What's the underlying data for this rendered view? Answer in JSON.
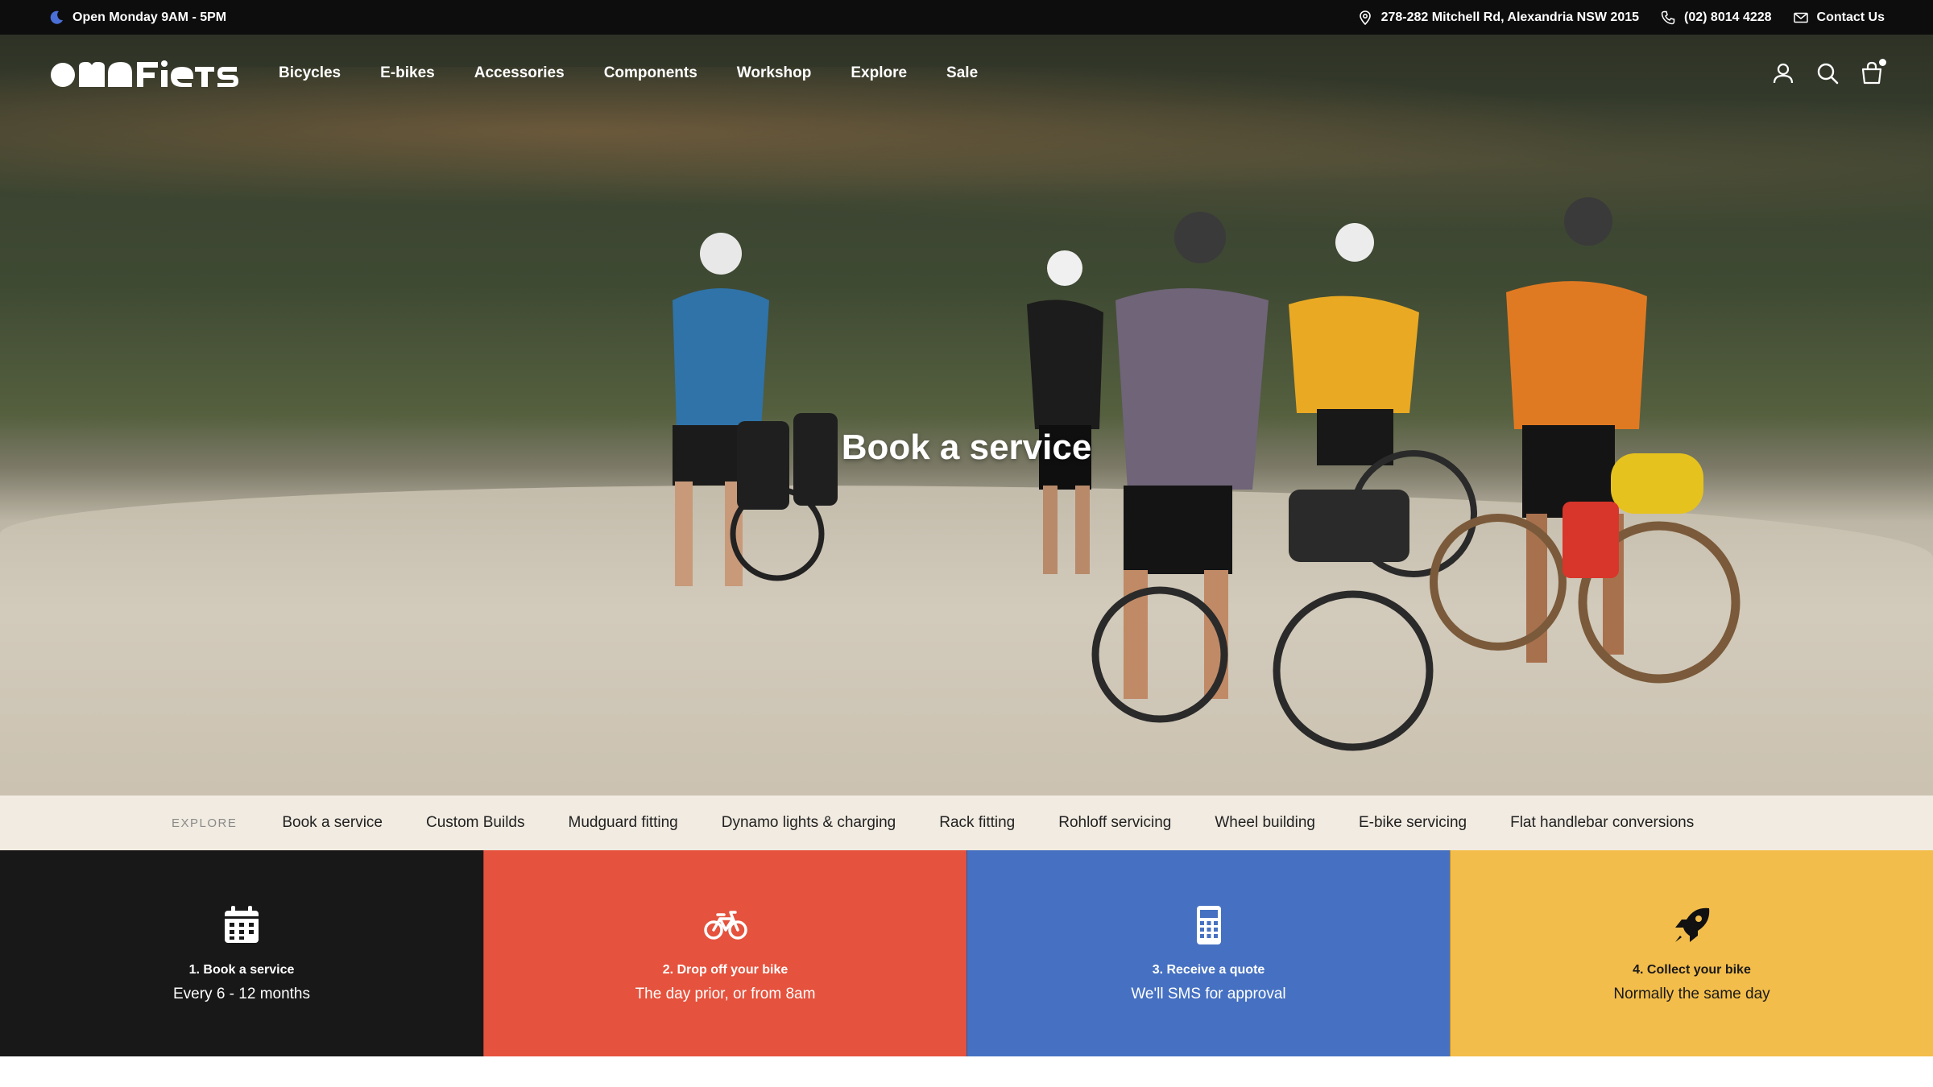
{
  "topbar": {
    "hours": "Open Monday 9AM - 5PM",
    "hours_icon": "moon-icon",
    "address": "278-282 Mitchell Rd, Alexandria NSW 2015",
    "address_icon": "map-pin-icon",
    "phone": "(02) 8014 4228",
    "phone_icon": "phone-icon",
    "contact": "Contact Us",
    "contact_icon": "envelope-icon"
  },
  "header": {
    "logo": "omafiets",
    "nav": [
      "Bicycles",
      "E-bikes",
      "Accessories",
      "Components",
      "Workshop",
      "Explore",
      "Sale"
    ],
    "icons": [
      "account-icon",
      "search-icon",
      "cart-icon"
    ]
  },
  "hero": {
    "title": "Book a service"
  },
  "explore": {
    "label": "EXPLORE",
    "links": [
      "Book a service",
      "Custom Builds",
      "Mudguard fitting",
      "Dynamo lights & charging",
      "Rack fitting",
      "Rohloff servicing",
      "Wheel building",
      "E-bike servicing",
      "Flat handlebar conversions"
    ]
  },
  "steps": [
    {
      "title": "1. Book a service",
      "desc": "Every 6 - 12 months",
      "icon": "calendar-icon",
      "color": "#181818"
    },
    {
      "title": "2. Drop off your bike",
      "desc": "The day prior, or from 8am",
      "icon": "bicycle-icon",
      "color": "#e5523d"
    },
    {
      "title": "3. Receive a quote",
      "desc": "We'll SMS for approval",
      "icon": "calculator-icon",
      "color": "#4671c2"
    },
    {
      "title": "4. Collect your bike",
      "desc": "Normally the same day",
      "icon": "rocket-icon",
      "color": "#f3bd4b"
    }
  ]
}
